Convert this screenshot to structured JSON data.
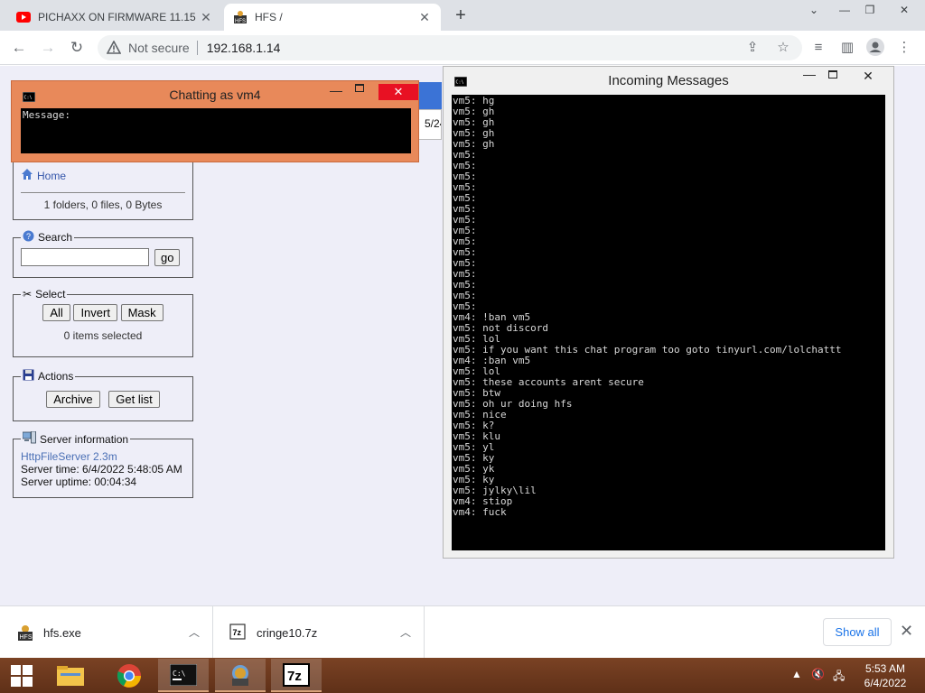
{
  "browser": {
    "tabs": [
      {
        "title": "PICHAXX ON FIRMWARE 11.15 -",
        "icon": "youtube-icon",
        "active": false
      },
      {
        "title": "HFS /",
        "icon": "hfs-icon",
        "active": true
      }
    ],
    "address": {
      "security_label": "Not secure",
      "url": "192.168.1.14"
    }
  },
  "hfs": {
    "home_label": "Home",
    "folder_summary": "1 folders, 0 files, 0 Bytes",
    "search": {
      "legend": "Search",
      "value": "",
      "go_label": "go"
    },
    "select": {
      "legend": "Select",
      "buttons": [
        "All",
        "Invert",
        "Mask"
      ],
      "status": "0 items selected"
    },
    "actions": {
      "legend": "Actions",
      "buttons": [
        "Archive",
        "Get list"
      ]
    },
    "server_info": {
      "legend": "Server information",
      "link": "HttpFileServer 2.3m",
      "server_time": "Server time: 6/4/2022 5:48:05 AM",
      "server_uptime": "Server uptime: 00:04:34"
    },
    "partial_date": "5/24"
  },
  "chat_window": {
    "title": "Chatting as vm4",
    "prompt": "Message:"
  },
  "messages_window": {
    "title": "Incoming Messages",
    "lines": [
      "vm5: hg",
      "vm5: gh",
      "vm5: gh",
      "vm5: gh",
      "vm5: gh",
      "vm5:",
      "vm5:",
      "vm5:",
      "vm5:",
      "vm5:",
      "vm5:",
      "vm5:",
      "vm5:",
      "vm5:",
      "vm5:",
      "vm5:",
      "vm5:",
      "vm5:",
      "vm5:",
      "vm5:",
      "vm4: !ban vm5",
      "vm5: not discord",
      "vm5: lol",
      "vm5: if you want this chat program too goto tinyurl.com/lolchattt",
      "vm4: :ban vm5",
      "vm5: lol",
      "vm5: these accounts arent secure",
      "vm5: btw",
      "vm5: oh ur doing hfs",
      "vm5: nice",
      "vm5: k?",
      "vm5: klu",
      "vm5: yl",
      "vm5: ky",
      "vm5: yk",
      "vm5: ky",
      "vm5: jylky\\lil",
      "vm4: stiop",
      "vm4: fuck"
    ]
  },
  "downloads": {
    "items": [
      {
        "name": "hfs.exe",
        "icon": "hfs-exe-icon"
      },
      {
        "name": "cringe10.7z",
        "icon": "7z-file-icon"
      }
    ],
    "show_all_label": "Show all"
  },
  "taskbar": {
    "time": "5:53 AM",
    "date": "6/4/2022",
    "apps": [
      "file-explorer-icon",
      "chrome-icon",
      "cmd-icon",
      "hfs-app-icon",
      "7zip-icon"
    ]
  },
  "colors": {
    "chat_window_bg": "#e8895a",
    "close_red": "#e81123",
    "taskbar_bg": "#6e3a1e",
    "page_bg": "#eeeef8",
    "link_blue": "#3355aa"
  }
}
